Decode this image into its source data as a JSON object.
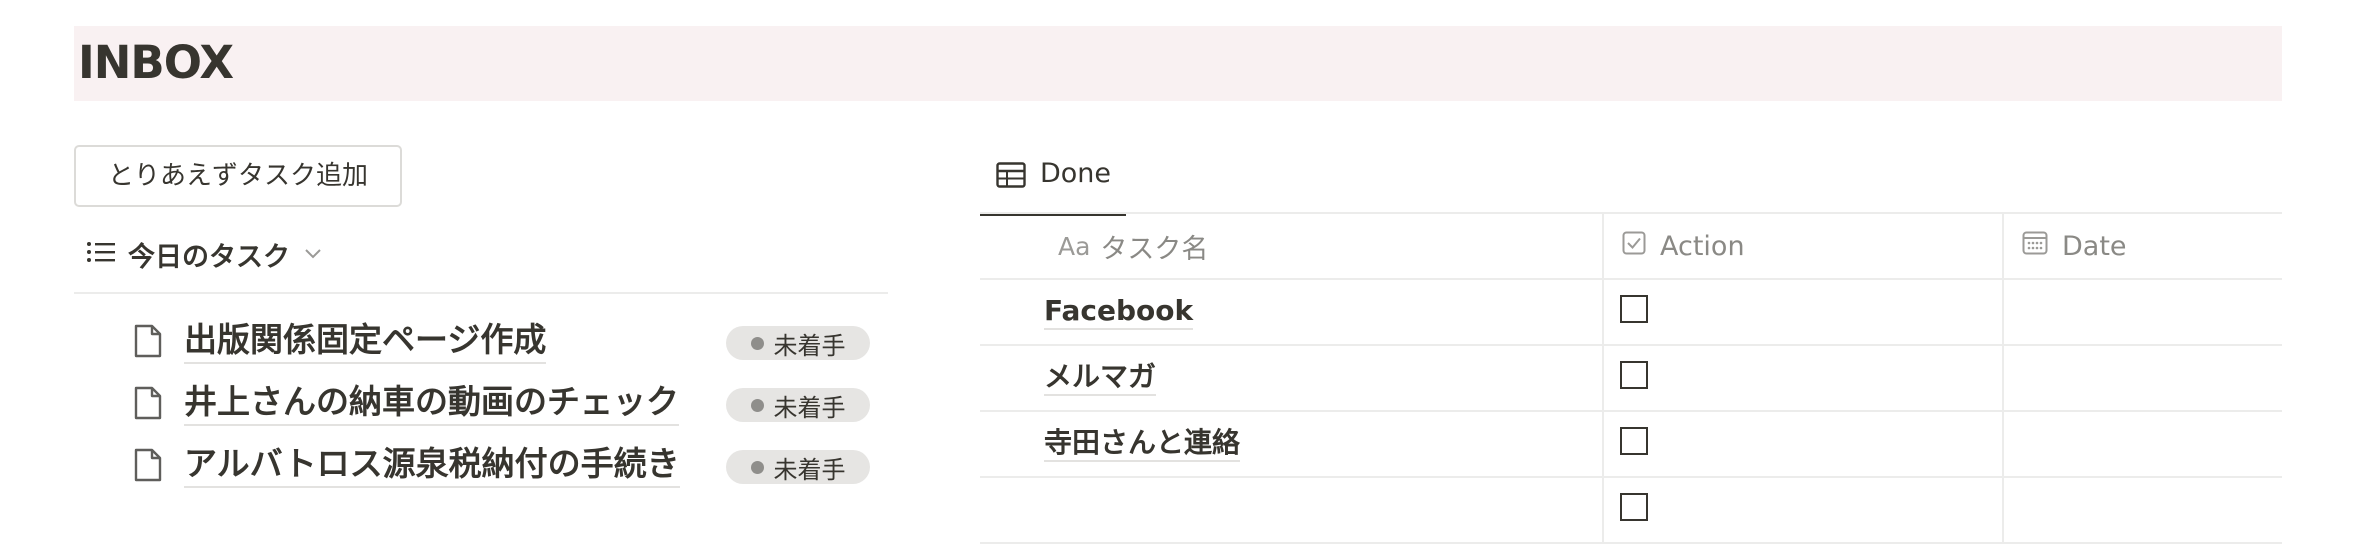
{
  "header": {
    "title": "INBOX"
  },
  "left": {
    "add_button_label": "とりあえずタスク追加",
    "view_label": "今日のタスク",
    "tasks": [
      {
        "title": "出版関係固定ページ作成",
        "status": "未着手"
      },
      {
        "title": "井上さんの納車の動画のチェック",
        "status": "未着手"
      },
      {
        "title": "アルバトロス源泉税納付の手続き",
        "status": "未着手"
      }
    ]
  },
  "right": {
    "tab_label": "Done",
    "columns": {
      "name_prefix": "Aa",
      "name": "タスク名",
      "action": "Action",
      "date": "Date"
    },
    "rows": [
      {
        "name": "Facebook",
        "action": false,
        "date": ""
      },
      {
        "name": "メルマガ",
        "action": false,
        "date": ""
      },
      {
        "name": "寺田さんと連絡",
        "action": false,
        "date": ""
      },
      {
        "name": "",
        "action": false,
        "date": ""
      }
    ]
  },
  "colors": {
    "header_bg": "#f9f1f2",
    "text": "#37352f",
    "badge_bg": "#e6e5e3",
    "muted": "#8a8985"
  },
  "icons": [
    "list-icon",
    "chevron-down-icon",
    "page-icon",
    "table-icon",
    "checkbox-icon",
    "calendar-icon"
  ]
}
